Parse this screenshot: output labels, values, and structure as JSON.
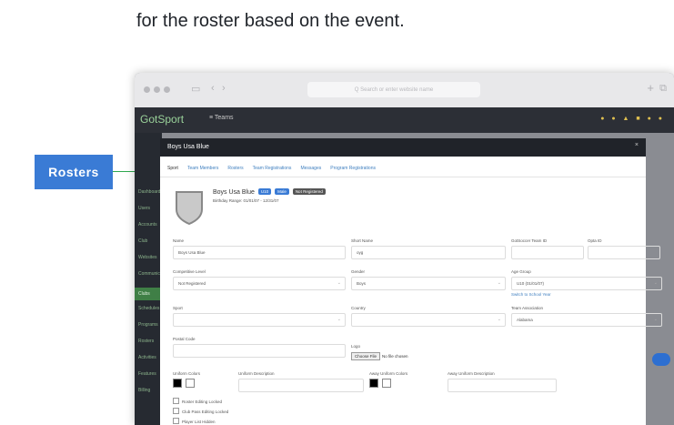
{
  "caption": "for the roster based on the event.",
  "callout": {
    "label": "Rosters"
  },
  "browser": {
    "url_placeholder": "Q Search or enter website name"
  },
  "app": {
    "logo": "GotSport",
    "section": "Teams",
    "sidebar": [
      "Dashboard",
      "Users",
      "Accounts",
      "Club",
      "Websites",
      "Communications",
      "Clubs",
      "Schedules",
      "Programs",
      "Rosters",
      "Activities",
      "Features",
      "Billing"
    ]
  },
  "modal": {
    "title": "Boys Usa Blue",
    "close": "×",
    "tabs": [
      "Sport",
      "Team Members",
      "Rosters",
      "Team Registrations",
      "Messages",
      "Program Registrations"
    ],
    "team_name": "Boys Usa Blue",
    "badges": [
      {
        "text": "U10",
        "color": "#3a7bd5"
      },
      {
        "text": "Male",
        "color": "#3a7bd5"
      },
      {
        "text": "Not Registered",
        "color": "#555555"
      }
    ],
    "birthday": "Birthday Range: 01/01/07 - 12/31/07",
    "fields": {
      "name_label": "Name",
      "name_value": "Boys Usa Blue",
      "short_label": "Short Name",
      "short_value": "oyg",
      "gs_label": "GotSoccer Team ID",
      "opta_label": "Opta ID",
      "level_label": "Competitive Level",
      "level_value": "Not Registered",
      "gender_label": "Gender",
      "gender_value": "Boys",
      "age_label": "Age Group",
      "age_value": "U10 (01/01/07)",
      "switch_link": "Switch to School Year",
      "sport_label": "Sport",
      "country_label": "Country",
      "assoc_label": "Team Association",
      "assoc_value": "Alabama",
      "postal_label": "Postal Code",
      "logo_label": "Logo",
      "choose_btn": "Choose File",
      "no_file": "No file chosen",
      "uni_colors_label": "Uniform Colors",
      "uni_desc_label": "Uniform Description",
      "away_colors_label": "Away Uniform Colors",
      "away_desc_label": "Away Uniform Description"
    },
    "checks": [
      "Roster Editing Locked",
      "Club Pass Editing Locked",
      "Player List Hidden"
    ]
  }
}
